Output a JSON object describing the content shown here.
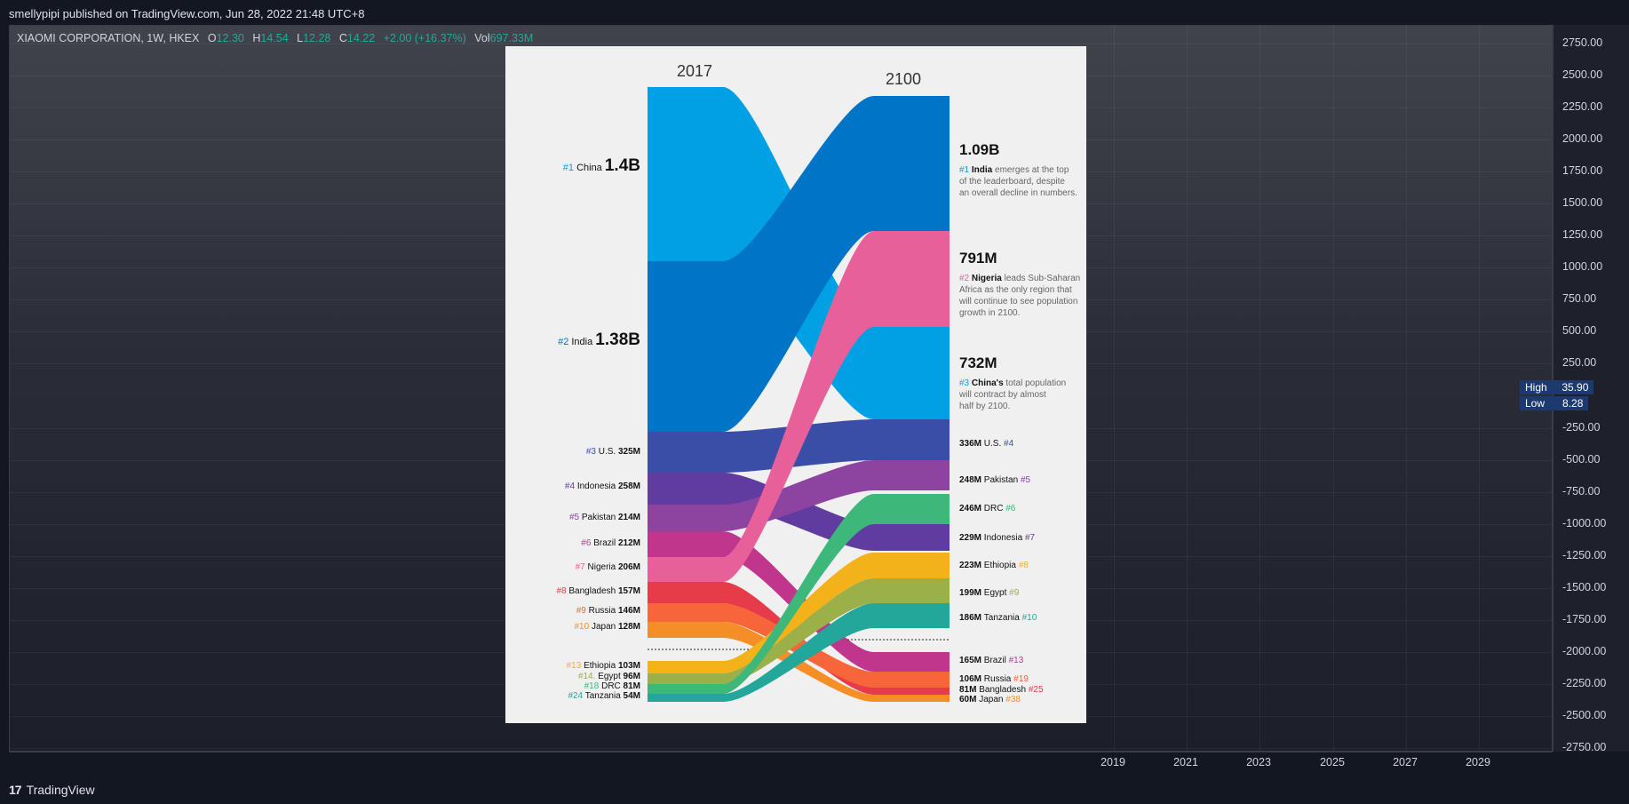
{
  "header": {
    "publisher_line": "smellypipi published on TradingView.com, Jun 28, 2022 21:48 UTC+8"
  },
  "legend": {
    "symbol": "XIAOMI CORPORATION, 1W, HKEX",
    "open_label": "O",
    "open": "12.30",
    "high_label": "H",
    "high": "14.54",
    "low_label": "L",
    "low": "12.28",
    "close_label": "C",
    "close": "14.22",
    "change": "+2.00 (+16.37%)",
    "vol_label": "Vol",
    "vol": "697.33M"
  },
  "price_axis": [
    "2750.00",
    "2500.00",
    "2250.00",
    "2000.00",
    "1750.00",
    "1500.00",
    "1250.00",
    "1000.00",
    "750.00",
    "500.00",
    "250.00",
    "-250.00",
    "-500.00",
    "-750.00",
    "-1000.00",
    "-1250.00",
    "-1500.00",
    "-1750.00",
    "-2000.00",
    "-2250.00",
    "-2500.00",
    "-2750.00"
  ],
  "high_low": {
    "high_label": "High",
    "high_value": "35.90",
    "low_label": "Low",
    "low_value": "8.28"
  },
  "time_axis": [
    "2019",
    "2021",
    "2023",
    "2025",
    "2027",
    "2029"
  ],
  "brand": {
    "logo": "17",
    "name": "TradingView"
  },
  "colors": {
    "up": "#26a69a",
    "axis_text": "#d1d4dc",
    "highlow_bg": "#1c3a6e"
  },
  "infographic": {
    "year_left": "2017",
    "year_right": "2100",
    "left_labels": [
      {
        "rank": "#1",
        "name": "China",
        "value": "1.4B",
        "color": "#00a0e4"
      },
      {
        "rank": "#2",
        "name": "India",
        "value": "1.38B",
        "color": "#0075c8"
      },
      {
        "rank": "#3",
        "name": "U.S.",
        "value": "325M",
        "color": "#3a4ea8"
      },
      {
        "rank": "#4",
        "name": "Indonesia",
        "value": "258M",
        "color": "#613ca0"
      },
      {
        "rank": "#5",
        "name": "Pakistan",
        "value": "214M",
        "color": "#8c44a0"
      },
      {
        "rank": "#6",
        "name": "Brazil",
        "value": "212M",
        "color": "#c0368c"
      },
      {
        "rank": "#7",
        "name": "Nigeria",
        "value": "206M",
        "color": "#e8609a"
      },
      {
        "rank": "#8",
        "name": "Bangladesh",
        "value": "157M",
        "color": "#e63b48"
      },
      {
        "rank": "#9",
        "name": "Russia",
        "value": "146M",
        "color": "#f7653a"
      },
      {
        "rank": "#10",
        "name": "Japan",
        "value": "128M",
        "color": "#f68e28"
      },
      {
        "rank": "#13",
        "name": "Ethiopia",
        "value": "103M",
        "color": "#f4b21a"
      },
      {
        "rank": "#14.",
        "name": "Egypt",
        "value": "96M",
        "color": "#9bb049"
      },
      {
        "rank": "#18",
        "name": "DRC",
        "value": "81M",
        "color": "#3db87a"
      },
      {
        "rank": "#24",
        "name": "Tanzania",
        "value": "54M",
        "color": "#22a79a"
      }
    ],
    "right_big": [
      {
        "value": "1.09B",
        "rank": "#1",
        "name": "India",
        "text": [
          "emerges at the top",
          "of the leaderboard, despite",
          "an overall decline in numbers."
        ]
      },
      {
        "value": "791M",
        "rank": "#2",
        "name": "Nigeria",
        "text": [
          "leads Sub-Saharan",
          "Africa as the only region that",
          "will continue to see population",
          "growth in 2100."
        ]
      },
      {
        "value": "732M",
        "rank": "#3",
        "name": "China's",
        "text": [
          "total population",
          "will contract by almost",
          "half by 2100."
        ]
      }
    ],
    "right_labels": [
      {
        "value": "336M",
        "name": "U.S.",
        "rank": "#4",
        "color": "#3a4ea8"
      },
      {
        "value": "248M",
        "name": "Pakistan",
        "rank": "#5",
        "color": "#8c44a0"
      },
      {
        "value": "246M",
        "name": "DRC",
        "rank": "#6",
        "color": "#3db87a"
      },
      {
        "value": "229M",
        "name": "Indonesia",
        "rank": "#7",
        "color": "#613ca0"
      },
      {
        "value": "223M",
        "name": "Ethiopia",
        "rank": "#8",
        "color": "#f4b21a"
      },
      {
        "value": "199M",
        "name": "Egypt",
        "rank": "#9",
        "color": "#9bb049"
      },
      {
        "value": "186M",
        "name": "Tanzania",
        "rank": "#10",
        "color": "#22a79a"
      },
      {
        "value": "165M",
        "name": "Brazil",
        "rank": "#13",
        "color": "#c0368c"
      },
      {
        "value": "106M",
        "name": "Russia",
        "rank": "#19",
        "color": "#f7653a"
      },
      {
        "value": "81M",
        "name": "Bangladesh",
        "rank": "#25",
        "color": "#e63b48"
      },
      {
        "value": "60M",
        "name": "Japan",
        "rank": "#38",
        "color": "#f68e28"
      }
    ]
  }
}
